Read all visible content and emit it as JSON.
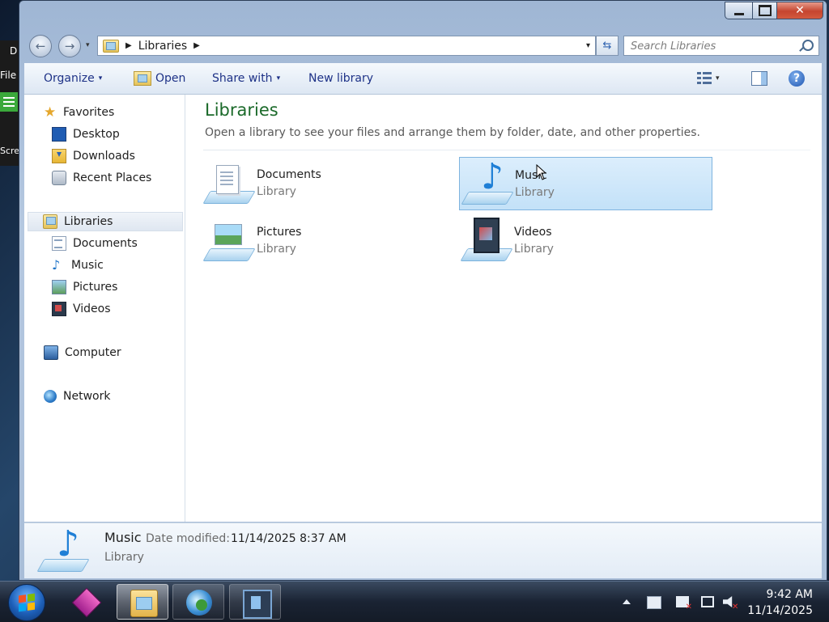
{
  "background_app": {
    "fragments": [
      "D",
      "File",
      "Scre"
    ]
  },
  "window": {
    "caption": {
      "minimize_icon": "minimize-icon",
      "maximize_icon": "maximize-icon",
      "close_icon": "close-icon",
      "close_glyph": "✕"
    },
    "nav": {
      "back_glyph": "←",
      "forward_glyph": "→",
      "recent_glyph": "▾"
    },
    "address": {
      "sep1": "▶",
      "crumb": "Libraries",
      "sep2": "▶",
      "dropdown_glyph": "▾",
      "refresh_glyph": "⇆"
    },
    "search": {
      "placeholder": "Search Libraries"
    }
  },
  "toolbar": {
    "organize": "Organize",
    "organize_caret": "▾",
    "open": "Open",
    "share_with": "Share with",
    "share_caret": "▾",
    "new_library": "New library",
    "views_caret": "▾",
    "help_glyph": "?"
  },
  "nav_pane": {
    "favorites": {
      "label": "Favorites",
      "items": [
        "Desktop",
        "Downloads",
        "Recent Places"
      ]
    },
    "libraries": {
      "label": "Libraries",
      "items": [
        "Documents",
        "Music",
        "Pictures",
        "Videos"
      ]
    },
    "computer": "Computer",
    "network": "Network"
  },
  "content": {
    "title": "Libraries",
    "subtitle": "Open a library to see your files and arrange them by folder, date, and other properties.",
    "tiles": [
      {
        "name": "Documents",
        "type": "Library",
        "icon": "documents-library-icon",
        "selected": false
      },
      {
        "name": "Music",
        "type": "Library",
        "icon": "music-library-icon",
        "selected": true
      },
      {
        "name": "Pictures",
        "type": "Library",
        "icon": "pictures-library-icon",
        "selected": false
      },
      {
        "name": "Videos",
        "type": "Library",
        "icon": "videos-library-icon",
        "selected": false
      }
    ]
  },
  "details": {
    "name": "Music",
    "date_label": "Date modified:",
    "date_value": "11/14/2025 8:37 AM",
    "type": "Library"
  },
  "taskbar": {
    "clock_time": "9:42 AM",
    "clock_date": "11/14/2025",
    "pinned": [
      "magenta-app-icon",
      "windows-explorer-icon",
      "globe-browser-icon",
      "video-editor-icon"
    ]
  },
  "colors": {
    "title_green": "#1b6a2a",
    "link_blue": "#1e3287",
    "selection": "#c3e1f8"
  }
}
